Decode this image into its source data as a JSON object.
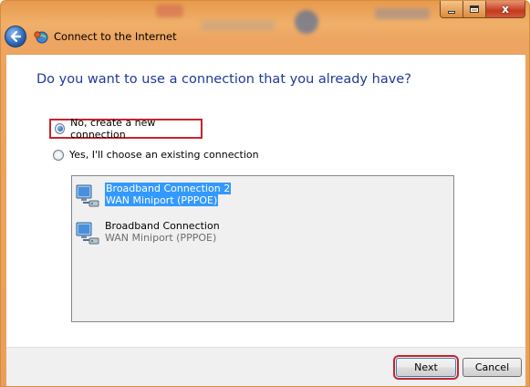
{
  "window": {
    "title": "Connect to the Internet",
    "close_glyph": "x"
  },
  "heading": "Do you want to use a connection that you already have?",
  "options": [
    {
      "label": "No, create a new connection",
      "selected": true
    },
    {
      "label": "Yes, I'll choose an existing connection",
      "selected": false
    }
  ],
  "connections": [
    {
      "name": "Broadband Connection 2",
      "device": "WAN Miniport (PPPOE)",
      "selected": true,
      "icon": "network-connection-icon"
    },
    {
      "name": "Broadband Connection",
      "device": "WAN Miniport (PPPOE)",
      "selected": false,
      "icon": "network-connection-icon"
    }
  ],
  "buttons": {
    "next": "Next",
    "cancel": "Cancel"
  },
  "colors": {
    "title_bar": "#e99f5a",
    "heading": "#1e3a96",
    "selection": "#3399ff",
    "highlight_border": "#c8232c"
  }
}
